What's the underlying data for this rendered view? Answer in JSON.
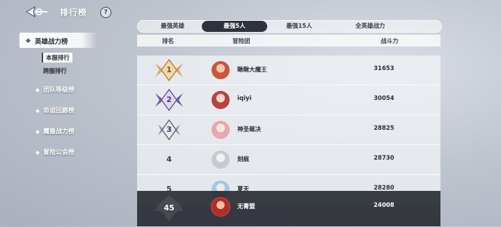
{
  "header": {
    "title": "排行榜",
    "help_label": "?"
  },
  "sidebar": {
    "active_main": "英雄战力榜",
    "subs": [
      {
        "label": "本服排行",
        "active": true
      },
      {
        "label": "跨服排行",
        "active": false
      }
    ],
    "items": [
      {
        "label": "团队等级榜"
      },
      {
        "label": "命运回廊榜"
      },
      {
        "label": "魔兽战力榜"
      },
      {
        "label": "冒险公会榜"
      }
    ]
  },
  "tabs": [
    {
      "label": "最强英雄",
      "active": false
    },
    {
      "label": "最强5人",
      "active": true
    },
    {
      "label": "最强15人",
      "active": false
    },
    {
      "label": "全英雄战力",
      "active": false
    }
  ],
  "table": {
    "headers": {
      "rank": "排名",
      "team": "冒险团",
      "power": "战斗力"
    },
    "rows": [
      {
        "rank": "1",
        "name": "瞅瞅大魔王",
        "power": "31653",
        "badge": "gold",
        "avatar_color": "#c8583a"
      },
      {
        "rank": "2",
        "name": "iqiyi",
        "power": "30054",
        "badge": "purple",
        "avatar_color": "#b8443e"
      },
      {
        "rank": "3",
        "name": "神圣裁决",
        "power": "28825",
        "badge": "silver",
        "avatar_color": "#e9a7b0"
      },
      {
        "rank": "4",
        "name": "刻痕",
        "power": "28730",
        "badge": "none",
        "avatar_color": "#d9d9df"
      },
      {
        "rank": "5",
        "name": "夏天",
        "power": "28280",
        "badge": "none",
        "avatar_color": "#9ec9e8"
      }
    ],
    "self": {
      "rank": "45",
      "name": "无膏盟",
      "power": "24008",
      "avatar_color": "#b42b2b"
    }
  },
  "colors": {
    "accent_dark": "#2e323c",
    "gold": "#d7a65a",
    "purple": "#6f5a9e",
    "silver": "#8f96a6"
  }
}
